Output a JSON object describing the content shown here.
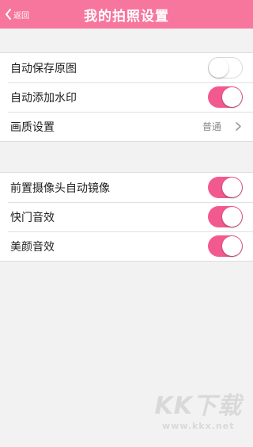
{
  "header": {
    "back_label": "返回",
    "title": "我的拍照设置",
    "accent_color": "#f7769d"
  },
  "group1": {
    "rows": [
      {
        "label": "自动保存原图",
        "toggle": "off"
      },
      {
        "label": "自动添加水印",
        "toggle": "on"
      },
      {
        "label": "画质设置",
        "value": "普通"
      }
    ]
  },
  "group2": {
    "rows": [
      {
        "label": "前置摄像头自动镜像",
        "toggle": "on"
      },
      {
        "label": "快门音效",
        "toggle": "on"
      },
      {
        "label": "美颜音效",
        "toggle": "on"
      }
    ]
  },
  "watermark": {
    "logo": "KK下载",
    "url": "www.kkx.net"
  }
}
